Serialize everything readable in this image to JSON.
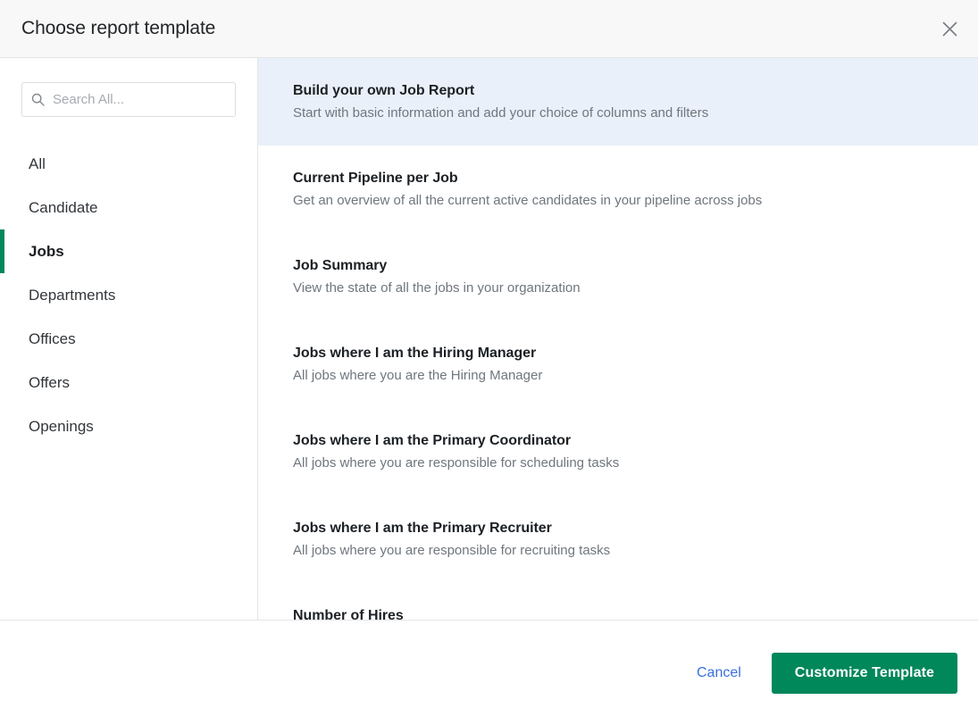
{
  "header": {
    "title": "Choose report template",
    "close_icon": "close-icon"
  },
  "sidebar": {
    "search": {
      "icon": "search-icon",
      "placeholder": "Search All...",
      "value": ""
    },
    "items": [
      {
        "label": "All",
        "active": false
      },
      {
        "label": "Candidate",
        "active": false
      },
      {
        "label": "Jobs",
        "active": true
      },
      {
        "label": "Departments",
        "active": false
      },
      {
        "label": "Offices",
        "active": false
      },
      {
        "label": "Offers",
        "active": false
      },
      {
        "label": "Openings",
        "active": false
      }
    ]
  },
  "templates": [
    {
      "name": "Build your own Job Report",
      "description": "Start with basic information and add your choice of columns and filters",
      "selected": true
    },
    {
      "name": "Current Pipeline per Job",
      "description": "Get an overview of all the current active candidates in your pipeline across jobs",
      "selected": false
    },
    {
      "name": "Job Summary",
      "description": "View the state of all the jobs in your organization",
      "selected": false
    },
    {
      "name": "Jobs where I am the Hiring Manager",
      "description": "All jobs where you are the Hiring Manager",
      "selected": false
    },
    {
      "name": "Jobs where I am the Primary Coordinator",
      "description": "All jobs where you are responsible for scheduling tasks",
      "selected": false
    },
    {
      "name": "Jobs where I am the Primary Recruiter",
      "description": "All jobs where you are responsible for recruiting tasks",
      "selected": false
    },
    {
      "name": "Number of Hires",
      "description": "",
      "selected": false
    }
  ],
  "footer": {
    "cancel_label": "Cancel",
    "primary_label": "Customize Template"
  },
  "colors": {
    "accent_green": "#00875a",
    "link_blue": "#3b6ee0",
    "selected_row": "#e9f0fa",
    "header_bg": "#f8f8f9",
    "border": "#e4e5e7"
  }
}
